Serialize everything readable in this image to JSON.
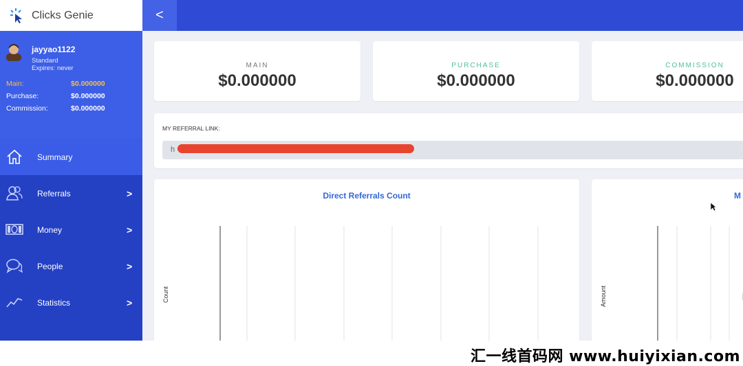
{
  "brand": {
    "name": "Clicks Genie"
  },
  "user": {
    "username": "jayyao1122",
    "plan": "Standard",
    "expires": "Expires: never",
    "balances": [
      {
        "label": "Main:",
        "value": "$0.000000"
      },
      {
        "label": "Purchase:",
        "value": "$0.000000"
      },
      {
        "label": "Commission:",
        "value": "$0.000000"
      }
    ]
  },
  "nav": [
    {
      "label": "Summary",
      "icon": "home-icon"
    },
    {
      "label": "Referrals",
      "icon": "users-icon"
    },
    {
      "label": "Money",
      "icon": "money-icon"
    },
    {
      "label": "People",
      "icon": "chat-icon"
    },
    {
      "label": "Statistics",
      "icon": "chart-icon"
    }
  ],
  "chevron": ">",
  "topbar": {
    "back": "<"
  },
  "stats": [
    {
      "label": "MAIN",
      "value": "$0.000000",
      "color": "#777777"
    },
    {
      "label": "PURCHASE",
      "value": "$0.000000",
      "color": "#4fbf9a"
    },
    {
      "label": "COMMISSION",
      "value": "$0.000000",
      "color": "#4fbf9a"
    }
  ],
  "referral": {
    "label": "MY REFERRAL LINK:",
    "value_start": "h"
  },
  "charts": [
    {
      "title": "Direct Referrals Count",
      "ylabel": "Count"
    },
    {
      "title": "M",
      "ylabel": "Amount"
    }
  ],
  "watermark": "汇一线首码网 www.huiyixian.com"
}
